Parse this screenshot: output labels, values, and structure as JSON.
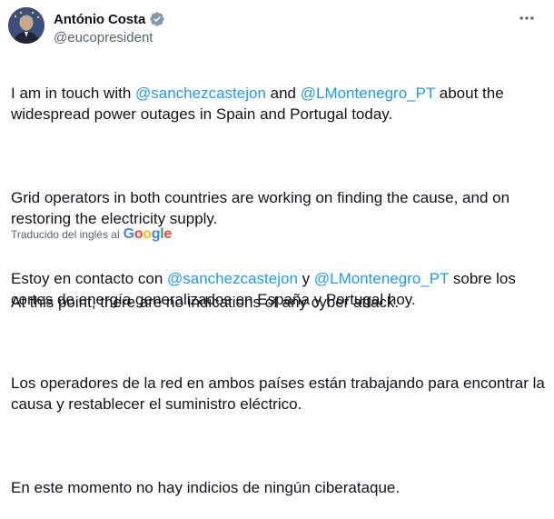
{
  "author": {
    "name": "António Costa",
    "handle": "@eucopresident",
    "verified_color": "#829aab"
  },
  "menu": {
    "icon": "more-horizontal-icon"
  },
  "tweet_en": {
    "p1_a": "I am in touch with ",
    "p1_m1": "@sanchezcastejon",
    "p1_b": " and ",
    "p1_m2": "@LMontenegro_PT",
    "p1_c": " about the widespread power outages in Spain and Portugal today.",
    "p2": "Grid operators in both countries are working on finding the cause, and on restoring the electricity supply.",
    "p3": "At this point, there are no indications of any cyber attack."
  },
  "translation": {
    "label": "Traducido del inglés al",
    "provider": "Google"
  },
  "tweet_es": {
    "p1_a": "Estoy en contacto con ",
    "p1_m1": "@sanchezcastejon",
    "p1_b": " y ",
    "p1_m2": "@LMontenegro_PT",
    "p1_c": " sobre los cortes de energía generalizados en España y Portugal hoy.",
    "p2": "Los operadores de la red en ambos países están trabajando para encontrar la causa y restablecer el suministro eléctrico.",
    "p3": "En este momento no hay indicios de ningún ciberataque."
  },
  "colors": {
    "mention": "#1d9bf0",
    "text": "#0f1419",
    "muted": "#536471"
  }
}
